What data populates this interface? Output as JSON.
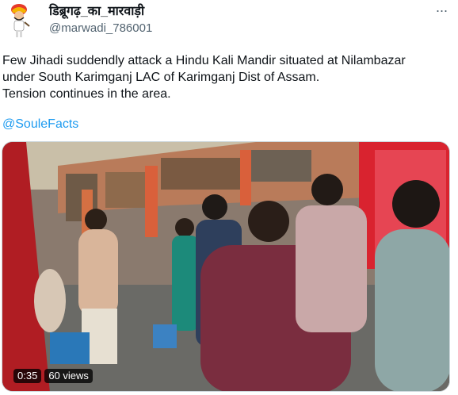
{
  "author": {
    "display_name": "डिब्रूगढ़_का_मारवाड़ी",
    "handle": "@marwadi_786001",
    "avatar_icon": "cartoon-turban-avatar-icon"
  },
  "more_icon": "more-options-icon",
  "tweet": {
    "lines": [
      "Few Jihadi suddendly attack a Hindu Kali Mandir situated at Nilambazar",
      "under South Karimganj LAC of Karimganj Dist of Assam.",
      "Tension continues in the area."
    ],
    "mention": "@SouleFacts"
  },
  "video": {
    "duration": "0:35",
    "views": "60 views"
  },
  "colors": {
    "link": "#1d9bf0",
    "text": "#0f1419",
    "secondary": "#536471"
  }
}
